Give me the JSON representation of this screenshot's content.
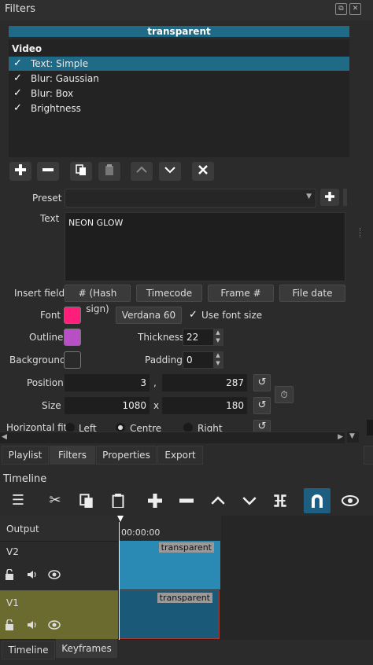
{
  "panel": {
    "title": "Filters"
  },
  "filter_header": "transparent",
  "filter_list": {
    "section": "Video",
    "items": [
      {
        "label": "Text: Simple",
        "checked": "✓",
        "selected": true
      },
      {
        "label": "Blur: Gaussian",
        "checked": "✓"
      },
      {
        "label": "Blur: Box",
        "checked": "✓"
      },
      {
        "label": "Brightness",
        "checked": "✓"
      }
    ]
  },
  "toolbar_icons": [
    "add-icon",
    "remove-icon",
    "copy-icon",
    "paste-icon",
    "move-up-icon",
    "move-down-icon",
    "close-icon"
  ],
  "form": {
    "preset_label": "Preset",
    "text_label": "Text",
    "text_value": "NEON GLOW",
    "insert_field_label": "Insert field",
    "insert_buttons": [
      "# (Hash sign)",
      "Timecode",
      "Frame #",
      "File date"
    ],
    "font_label": "Font",
    "font_color": "#ff1f7a",
    "font_button": "Verdana 60",
    "use_font_size_label": "Use font size",
    "outline_label": "Outline",
    "outline_color": "#b84fc4",
    "thickness_label": "Thickness",
    "thickness_value": "22",
    "background_label": "Background",
    "background_color": "#2a2a2a",
    "padding_label": "Padding",
    "padding_value": "0",
    "position_label": "Position",
    "position_x": "3",
    "position_sep": ",",
    "position_y": "287",
    "size_label": "Size",
    "size_w": "1080",
    "size_sep": "x",
    "size_h": "180",
    "hfit_label": "Horizontal fit",
    "hfit_options": [
      "Left",
      "Centre",
      "Right"
    ],
    "hfit_selected": "Centre"
  },
  "tabs": [
    "Playlist",
    "Filters",
    "Properties",
    "Export"
  ],
  "active_tab": "Filters",
  "timeline": {
    "title": "Timeline",
    "output_label": "Output",
    "timecode": "00:00:00",
    "tracks": [
      {
        "name": "V2",
        "clip": "transparent"
      },
      {
        "name": "V1",
        "clip": "transparent"
      }
    ]
  },
  "bottom_tabs": [
    "Timeline",
    "Keyframes"
  ],
  "colors": {
    "accent": "#1f6a87",
    "v1_track": "#6b6a2f",
    "clip_v2": "#2a8ab4",
    "clip_v1": "#1a5a78",
    "snap_active": "#1e5e80"
  }
}
